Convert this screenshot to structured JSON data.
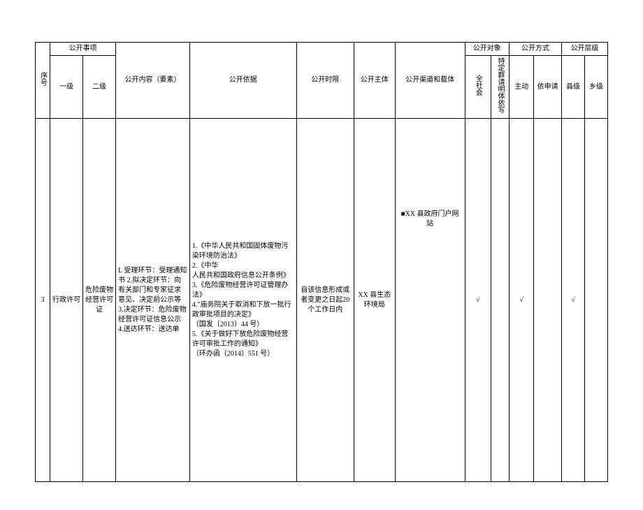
{
  "headers": {
    "seq": "序号",
    "matter": "公开事项",
    "level1": "一级",
    "level2": "二级",
    "content": "公开内容（要素）",
    "basis": "公开依据",
    "timelimit": "公开时限",
    "subject": "公开主体",
    "channel": "公开渠道和载体",
    "target": "公开对象",
    "all_society": "全社会",
    "specific_group": "特定群请明体依写",
    "method": "公开方式",
    "active": "主动",
    "on_request": "依申请",
    "level": "公开层级",
    "county": "县级",
    "township": "乡级"
  },
  "row": {
    "seq": "3",
    "level1": "行政许可",
    "level2": "危险废物经营许可证",
    "content": "L 受理环节：受理通知书 2.拟决定环节：向有关部门和专家征求意见、决定前公示等 3.决定环节：危险废物经营许可证信息公示 4.送达环节：送达单",
    "basis": "1.《中华人民共和国固体废物污染环境防治法》\n2.《中华\n人民共和国政府信息公开条例》\n3.《危险废物经营许可证管理办法》\n4.\"庙务院关于取消和下放一批行政审批项目的决定》\n（国发〔2013〕44 号）\n5.《关于做好下放危险废物经营许可审批工作的通知》\n（环办函〔2014〕551 号）",
    "timelimit": "自该信息形成或者变更之日起20 个工作日内",
    "subject": "XX 县生态环境局",
    "channel": "■XX 县政府门户网站",
    "all_society": "√",
    "specific_group": "",
    "active": "√",
    "on_request": "",
    "county": "√",
    "township": ""
  }
}
